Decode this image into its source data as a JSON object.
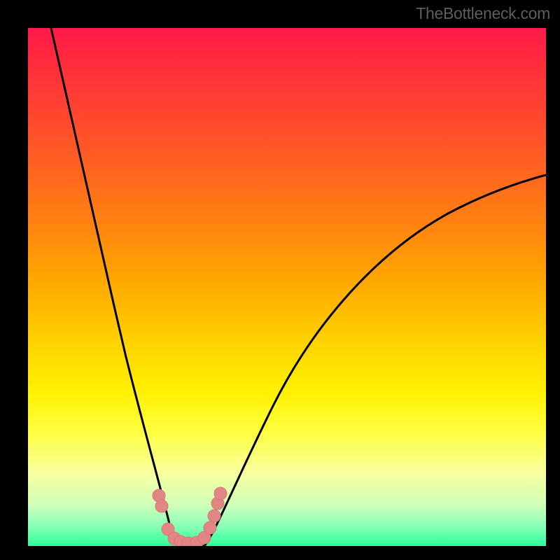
{
  "attribution": "TheBottleneck.com",
  "colors": {
    "frame": "#000000",
    "curve": "#000000",
    "marker_fill": "#e28585",
    "marker_stroke": "#d87878",
    "gradient_top": "#ff1a4a",
    "gradient_bottom": "#2cff9c"
  },
  "chart_data": {
    "type": "line",
    "title": "",
    "xlabel": "",
    "ylabel": "",
    "xlim": [
      0,
      100
    ],
    "ylim": [
      0,
      100
    ],
    "note": "No axis ticks or numeric labels are rendered in the image; values are normalized 0–100 estimates from pixel positions.",
    "series": [
      {
        "name": "curve-left",
        "x": [
          4.5,
          6,
          8,
          10,
          12,
          14,
          16,
          18,
          20,
          22,
          24,
          25.5,
          27,
          28
        ],
        "y": [
          100,
          89,
          76,
          64,
          54,
          45,
          37,
          30,
          23,
          17,
          11,
          7,
          3,
          0
        ]
      },
      {
        "name": "curve-right",
        "x": [
          34,
          36,
          38,
          41,
          45,
          50,
          56,
          63,
          71,
          80,
          90,
          100
        ],
        "y": [
          0,
          4,
          9,
          15,
          23,
          32,
          41,
          49,
          56,
          62,
          67,
          71
        ]
      },
      {
        "name": "valley-floor",
        "x": [
          28,
          30,
          32,
          34
        ],
        "y": [
          0,
          0,
          0,
          0
        ]
      }
    ],
    "markers": [
      {
        "x": 25.3,
        "y": 9.8
      },
      {
        "x": 25.8,
        "y": 7.7
      },
      {
        "x": 27.0,
        "y": 3.2
      },
      {
        "x": 28.2,
        "y": 1.4
      },
      {
        "x": 29.5,
        "y": 0.8
      },
      {
        "x": 31.0,
        "y": 0.5
      },
      {
        "x": 32.5,
        "y": 0.7
      },
      {
        "x": 34.0,
        "y": 1.6
      },
      {
        "x": 35.2,
        "y": 3.5
      },
      {
        "x": 35.9,
        "y": 5.8
      },
      {
        "x": 36.6,
        "y": 8.3
      },
      {
        "x": 37.2,
        "y": 10.1
      }
    ]
  }
}
